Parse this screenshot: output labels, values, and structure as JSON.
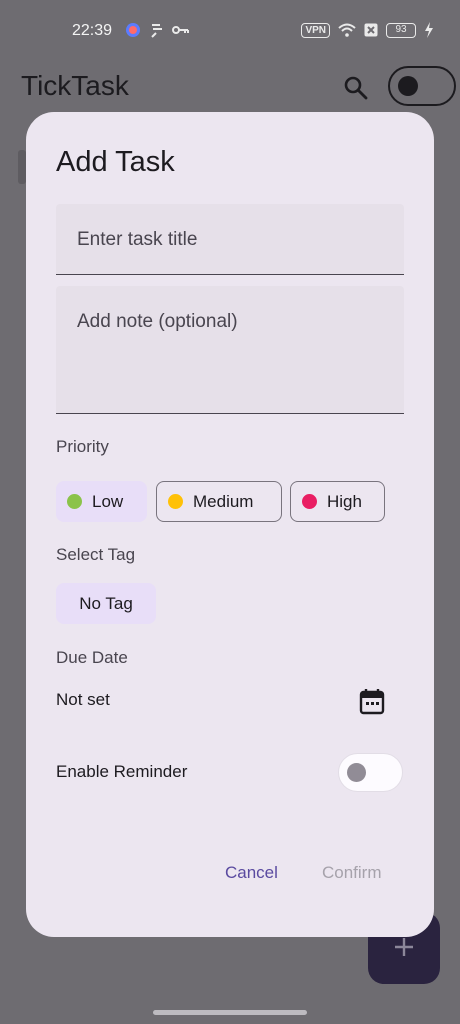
{
  "status_bar": {
    "time": "22:39",
    "vpn": "VPN",
    "battery": "93"
  },
  "app": {
    "title": "TickTask"
  },
  "dialog": {
    "title": "Add Task",
    "title_placeholder": "Enter task title",
    "note_placeholder": "Add note (optional)",
    "priority_label": "Priority",
    "priorities": [
      {
        "label": "Low",
        "color": "#8bc34a",
        "selected": true
      },
      {
        "label": "Medium",
        "color": "#ffc107",
        "selected": false
      },
      {
        "label": "High",
        "color": "#e91e63",
        "selected": false
      }
    ],
    "tag_label": "Select Tag",
    "tag_value": "No Tag",
    "due_label": "Due Date",
    "due_value": "Not set",
    "reminder_label": "Enable Reminder",
    "reminder_enabled": false,
    "cancel_label": "Cancel",
    "confirm_label": "Confirm"
  },
  "icons": [
    "search-icon",
    "calendar-icon",
    "add-icon",
    "wifi-icon",
    "key-icon"
  ],
  "colors": {
    "accent": "#5a4aa0",
    "dialog_bg": "#ece6f0",
    "chip_selected": "#e8def8"
  }
}
